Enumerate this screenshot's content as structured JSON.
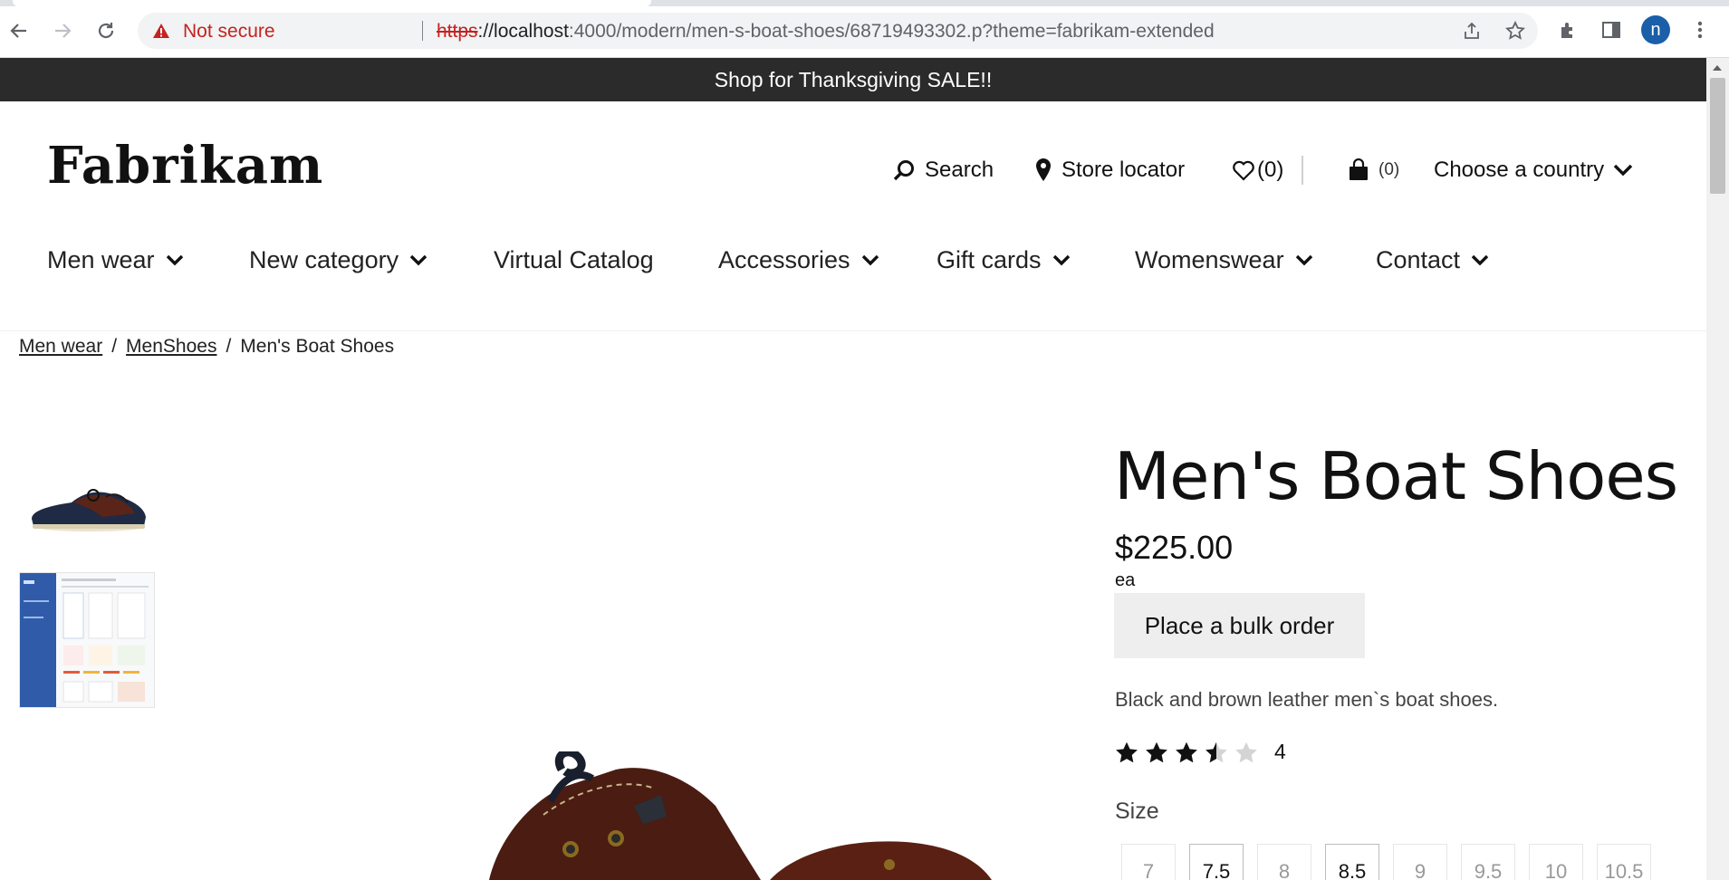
{
  "browser": {
    "not_secure_label": "Not secure",
    "url_scheme": "https",
    "url_host": "://localhost",
    "url_rest": ":4000/modern/men-s-boat-shoes/68719493302.p?theme=fabrikam-extended",
    "profile_initial": "n",
    "colors": {
      "warning": "#c5221f",
      "profile": "#1a5fa8"
    }
  },
  "banner": {
    "text": "Shop for Thanksgiving SALE!!"
  },
  "header": {
    "logo": "Fabrikam",
    "search_label": "Search",
    "store_locator_label": "Store locator",
    "wishlist_count": "(0)",
    "cart_count": "(0)",
    "country_label": "Choose a country"
  },
  "nav": {
    "items": [
      {
        "label": "Men wear",
        "has_dropdown": true
      },
      {
        "label": "New category",
        "has_dropdown": true
      },
      {
        "label": "Virtual Catalog",
        "has_dropdown": false
      },
      {
        "label": "Accessories",
        "has_dropdown": true
      },
      {
        "label": "Gift cards",
        "has_dropdown": true
      },
      {
        "label": "Womenswear",
        "has_dropdown": true
      },
      {
        "label": "Contact",
        "has_dropdown": true
      }
    ]
  },
  "breadcrumb": {
    "items": [
      "Men wear",
      "MenShoes",
      "Men's Boat Shoes"
    ],
    "separator": "/"
  },
  "product": {
    "title": "Men's Boat Shoes",
    "price": "$225.00",
    "unit": "ea",
    "bulk_order_label": "Place a bulk order",
    "description": "Black and brown leather men`s boat shoes.",
    "rating": 3.5,
    "rating_count": "4",
    "size_label": "Size",
    "sizes": [
      {
        "label": "7",
        "available": false
      },
      {
        "label": "7.5",
        "available": true
      },
      {
        "label": "8",
        "available": false
      },
      {
        "label": "8.5",
        "available": true
      },
      {
        "label": "9",
        "available": false
      },
      {
        "label": "9.5",
        "available": false
      },
      {
        "label": "10",
        "available": false
      },
      {
        "label": "10.5",
        "available": false
      }
    ]
  }
}
